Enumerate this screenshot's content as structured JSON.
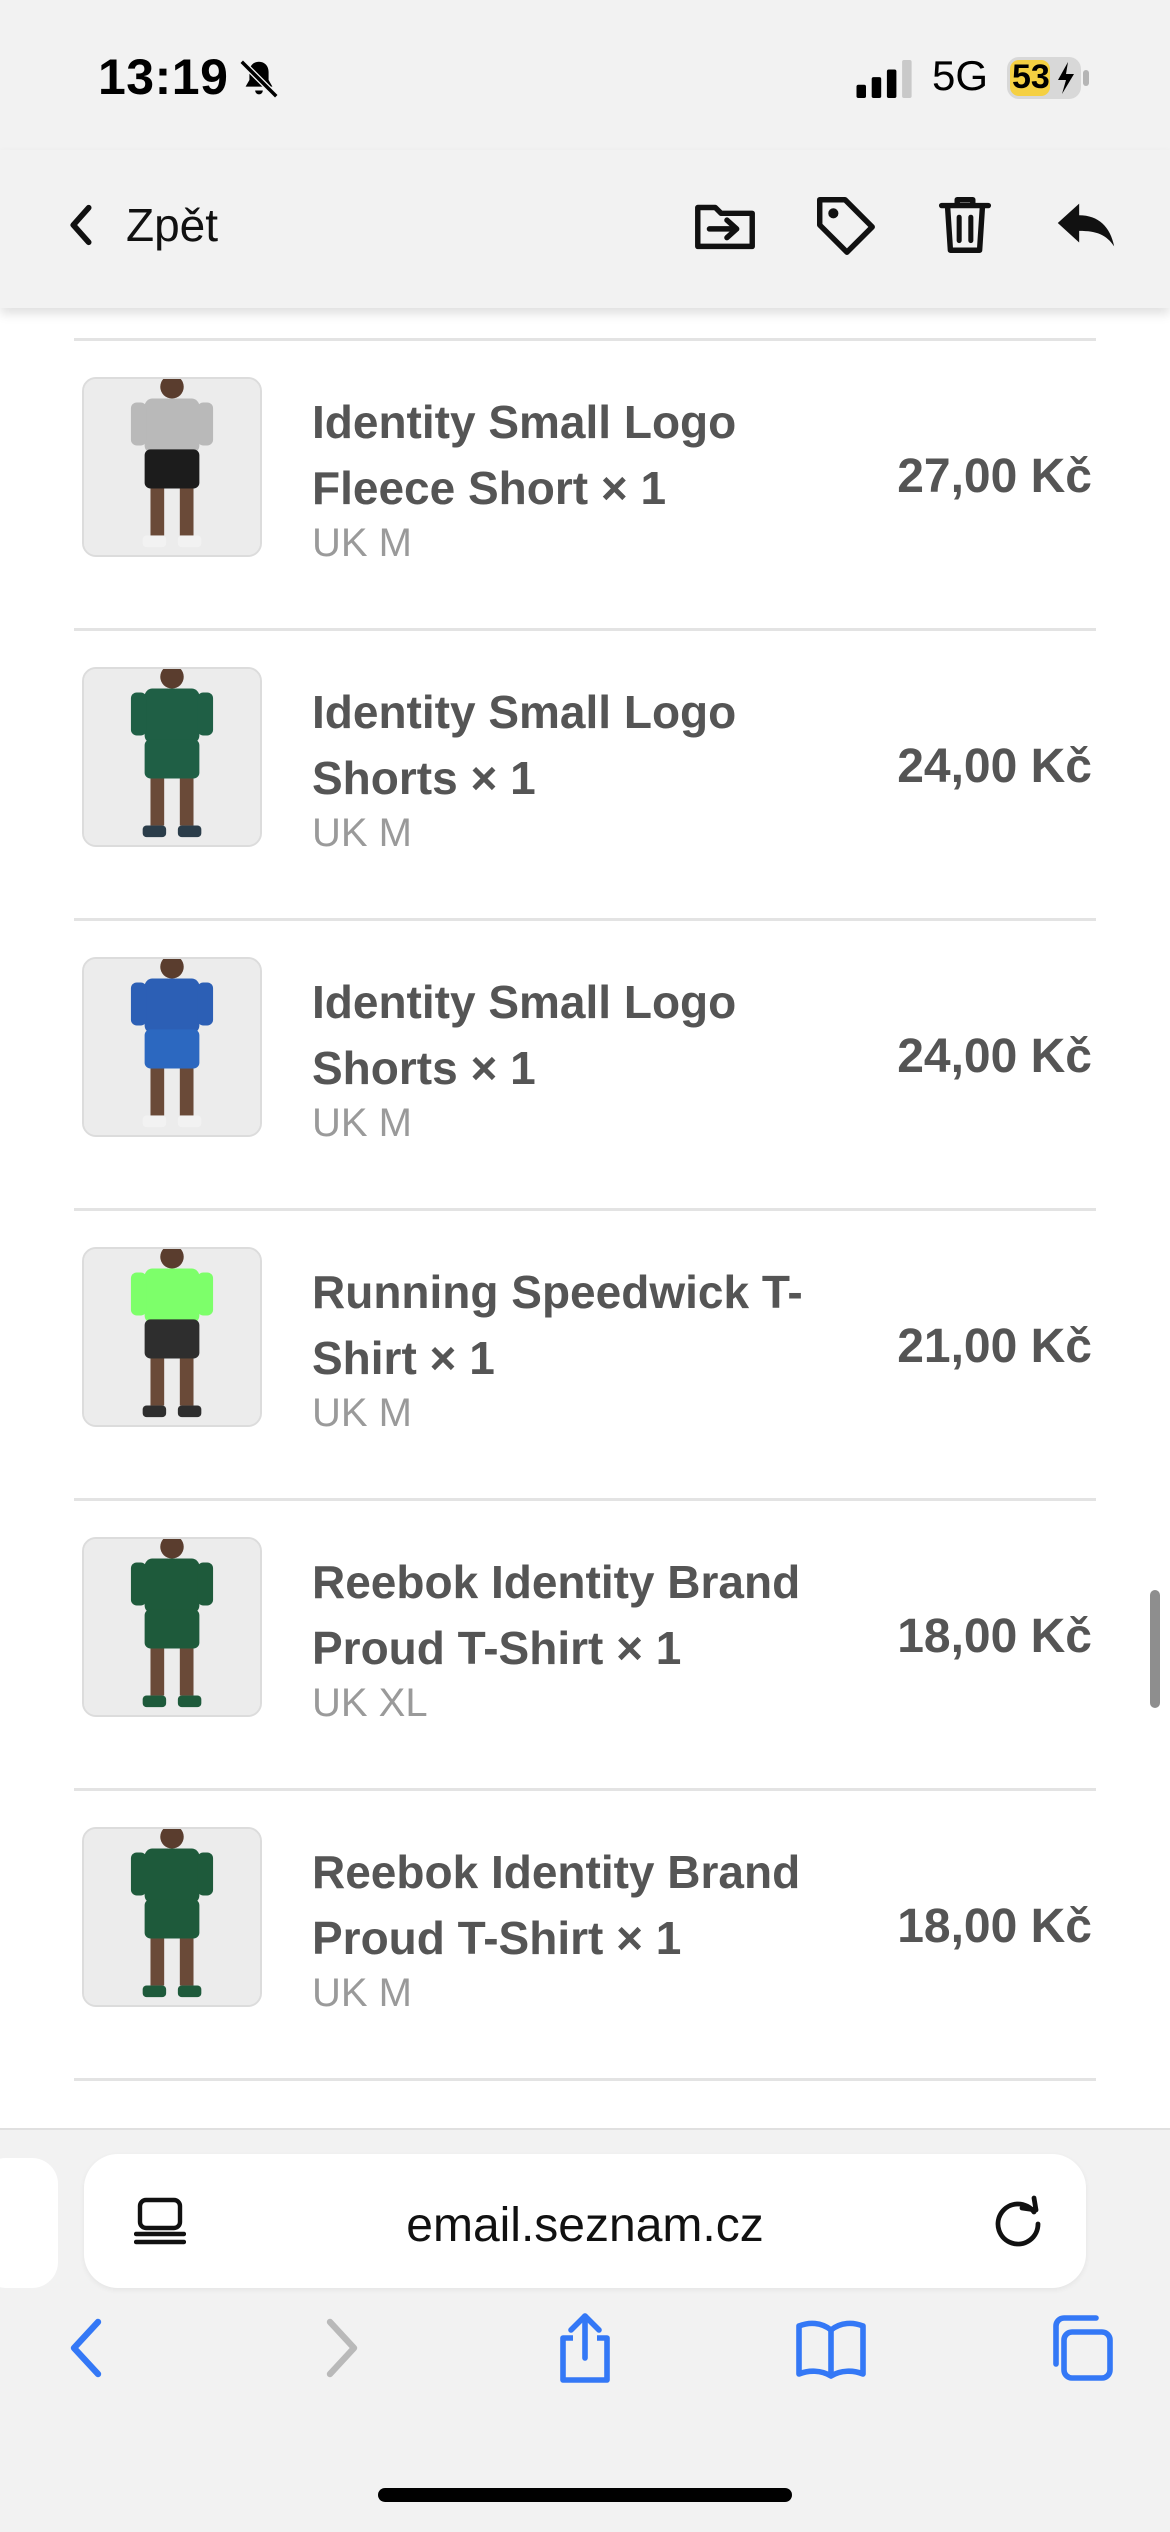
{
  "status_bar": {
    "time": "13:19",
    "network": "5G",
    "battery": "53"
  },
  "toolbar": {
    "back_label": "Zpět"
  },
  "items": [
    {
      "title": "Identity Small Logo Fleece Short × 1",
      "size": "UK M",
      "price": "27,00 Kč",
      "colors": {
        "top": "#b9b9b9",
        "bottom": "#1c1c1c",
        "shoes": "#f2f2f2"
      }
    },
    {
      "title": "Identity Small Logo Shorts × 1",
      "size": "UK M",
      "price": "24,00 Kč",
      "colors": {
        "top": "#1f5f45",
        "bottom": "#1f5f45",
        "shoes": "#2b3d4a"
      }
    },
    {
      "title": "Identity Small Logo Shorts × 1",
      "size": "UK M",
      "price": "24,00 Kč",
      "colors": {
        "top": "#2c5fb5",
        "bottom": "#2c68c0",
        "shoes": "#f2f2f2"
      }
    },
    {
      "title": "Running Speedwick T-Shirt × 1",
      "size": "UK M",
      "price": "21,00 Kč",
      "colors": {
        "top": "#7dff6a",
        "bottom": "#2e2e2e",
        "shoes": "#2e2e2e"
      }
    },
    {
      "title": "Reebok Identity Brand Proud T-Shirt × 1",
      "size": "UK XL",
      "price": "18,00 Kč",
      "colors": {
        "top": "#1e5a3b",
        "bottom": "#1e5a3b",
        "shoes": "#1e5a3b"
      }
    },
    {
      "title": "Reebok Identity Brand Proud T-Shirt × 1",
      "size": "UK M",
      "price": "18,00 Kč",
      "colors": {
        "top": "#1e5a3b",
        "bottom": "#1e5a3b",
        "shoes": "#1e5a3b"
      }
    }
  ],
  "browser": {
    "url": "email.seznam.cz"
  },
  "colors": {
    "accent": "#3478f6",
    "text_muted": "#9a9a9a",
    "text_item": "#555555"
  }
}
